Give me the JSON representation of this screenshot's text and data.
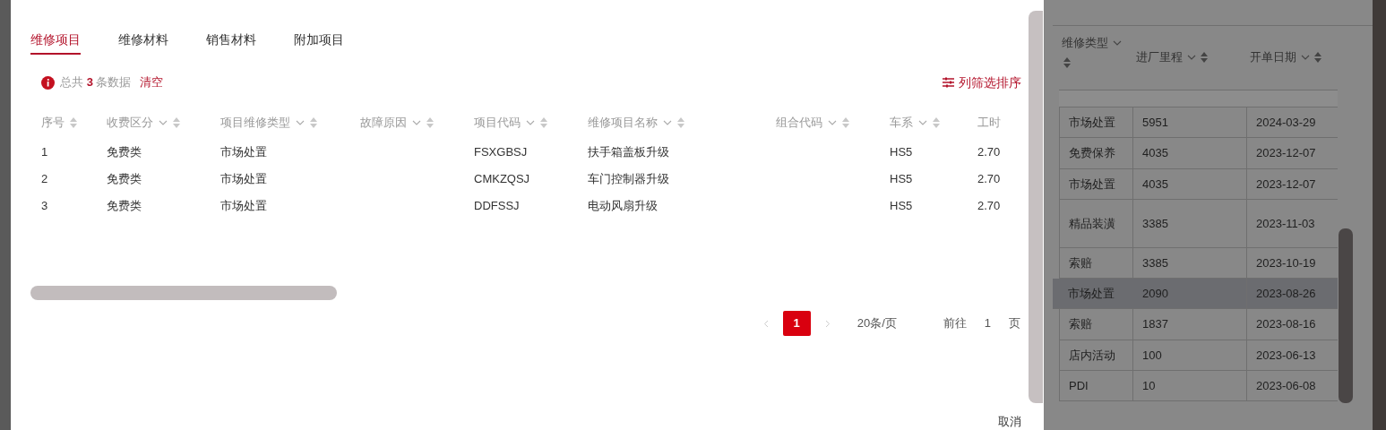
{
  "tabs": [
    {
      "label": "维修项目",
      "selected": true
    },
    {
      "label": "维修材料",
      "selected": false
    },
    {
      "label": "销售材料",
      "selected": false
    },
    {
      "label": "附加项目",
      "selected": false
    }
  ],
  "summary": {
    "prefix": "总共",
    "count": "3",
    "suffix": "条数据",
    "clear": "清空"
  },
  "column_settings": "列筛选排序",
  "table": {
    "columns": [
      {
        "label": "序号",
        "filter": false
      },
      {
        "label": "收费区分",
        "filter": true
      },
      {
        "label": "项目维修类型",
        "filter": true
      },
      {
        "label": "故障原因",
        "filter": true
      },
      {
        "label": "项目代码",
        "filter": true
      },
      {
        "label": "维修项目名称",
        "filter": true
      },
      {
        "label": "组合代码",
        "filter": true
      },
      {
        "label": "车系",
        "filter": true
      },
      {
        "label": "工时",
        "filter": false
      }
    ],
    "rows": [
      [
        "1",
        "免费类",
        "市场处置",
        "",
        "FSXGBSJ",
        "扶手箱盖板升级",
        "",
        "HS5",
        "2.70"
      ],
      [
        "2",
        "免费类",
        "市场处置",
        "",
        "CMKZQSJ",
        "车门控制器升级",
        "",
        "HS5",
        "2.70"
      ],
      [
        "3",
        "免费类",
        "市场处置",
        "",
        "DDFSSJ",
        "电动风扇升级",
        "",
        "HS5",
        "2.70"
      ]
    ]
  },
  "pagination": {
    "pages": [
      {
        "label": "1",
        "selected": true
      }
    ],
    "page_size": "20条/页",
    "goto_label": "前往",
    "goto_value": "1",
    "page_suffix": "页"
  },
  "footer": {
    "cancel": "取消"
  },
  "background_table": {
    "columns": [
      {
        "label": "维修类型"
      },
      {
        "label": "进厂里程"
      },
      {
        "label": "开单日期"
      }
    ],
    "rows": [
      {
        "cells": [
          "市场处置",
          "5951",
          "2024-03-29"
        ],
        "selected": false
      },
      {
        "cells": [
          "免费保养",
          "4035",
          "2023-12-07"
        ],
        "selected": false
      },
      {
        "cells": [
          "市场处置",
          "4035",
          "2023-12-07"
        ],
        "selected": false
      },
      {
        "cells": [
          "精品装潢",
          "3385",
          "2023-11-03"
        ],
        "selected": false
      },
      {
        "cells": [
          "索赔",
          "3385",
          "2023-10-19"
        ],
        "selected": false
      },
      {
        "cells": [
          "市场处置",
          "2090",
          "2023-08-26"
        ],
        "selected": true
      },
      {
        "cells": [
          "索赔",
          "1837",
          "2023-08-16"
        ],
        "selected": false
      },
      {
        "cells": [
          "店内活动",
          "100",
          "2023-06-13"
        ],
        "selected": false
      },
      {
        "cells": [
          "PDI",
          "10",
          "2023-06-08"
        ],
        "selected": false
      }
    ]
  }
}
